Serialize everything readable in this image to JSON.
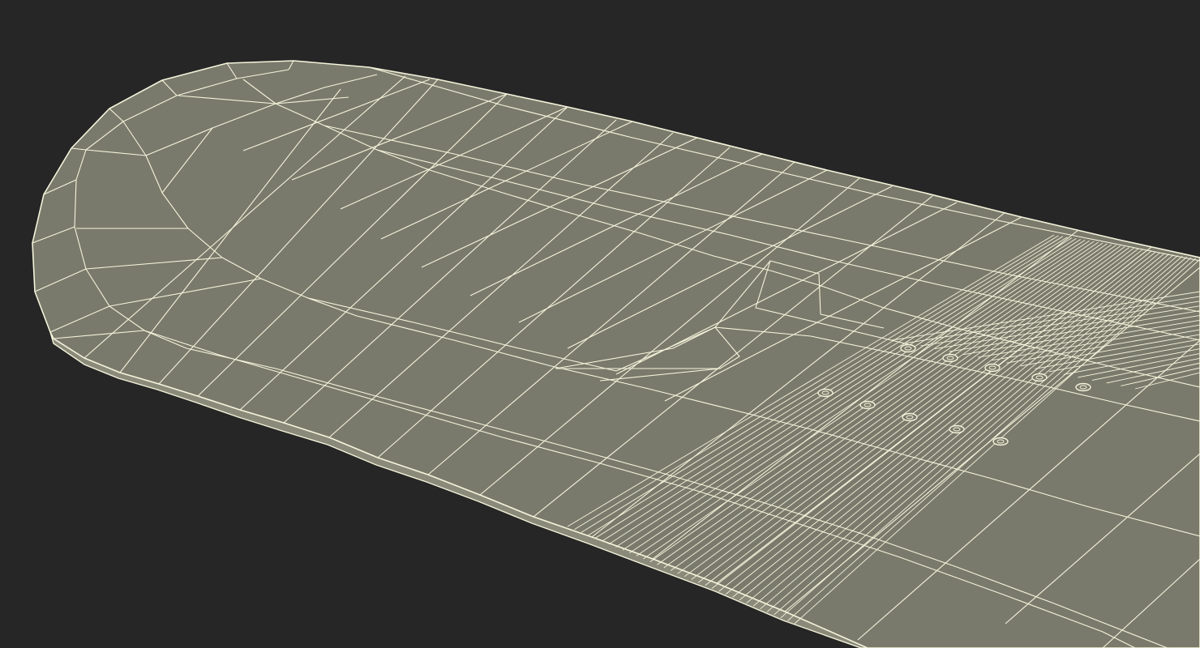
{
  "scene": {
    "subject": "skateboard-deck-wireframe",
    "colors": {
      "background": "#262626",
      "surface": "#7a7a6c",
      "edge_band": "#8a8a7a",
      "wire": "#f4f4dc"
    },
    "truck_mount_holes": 10
  }
}
